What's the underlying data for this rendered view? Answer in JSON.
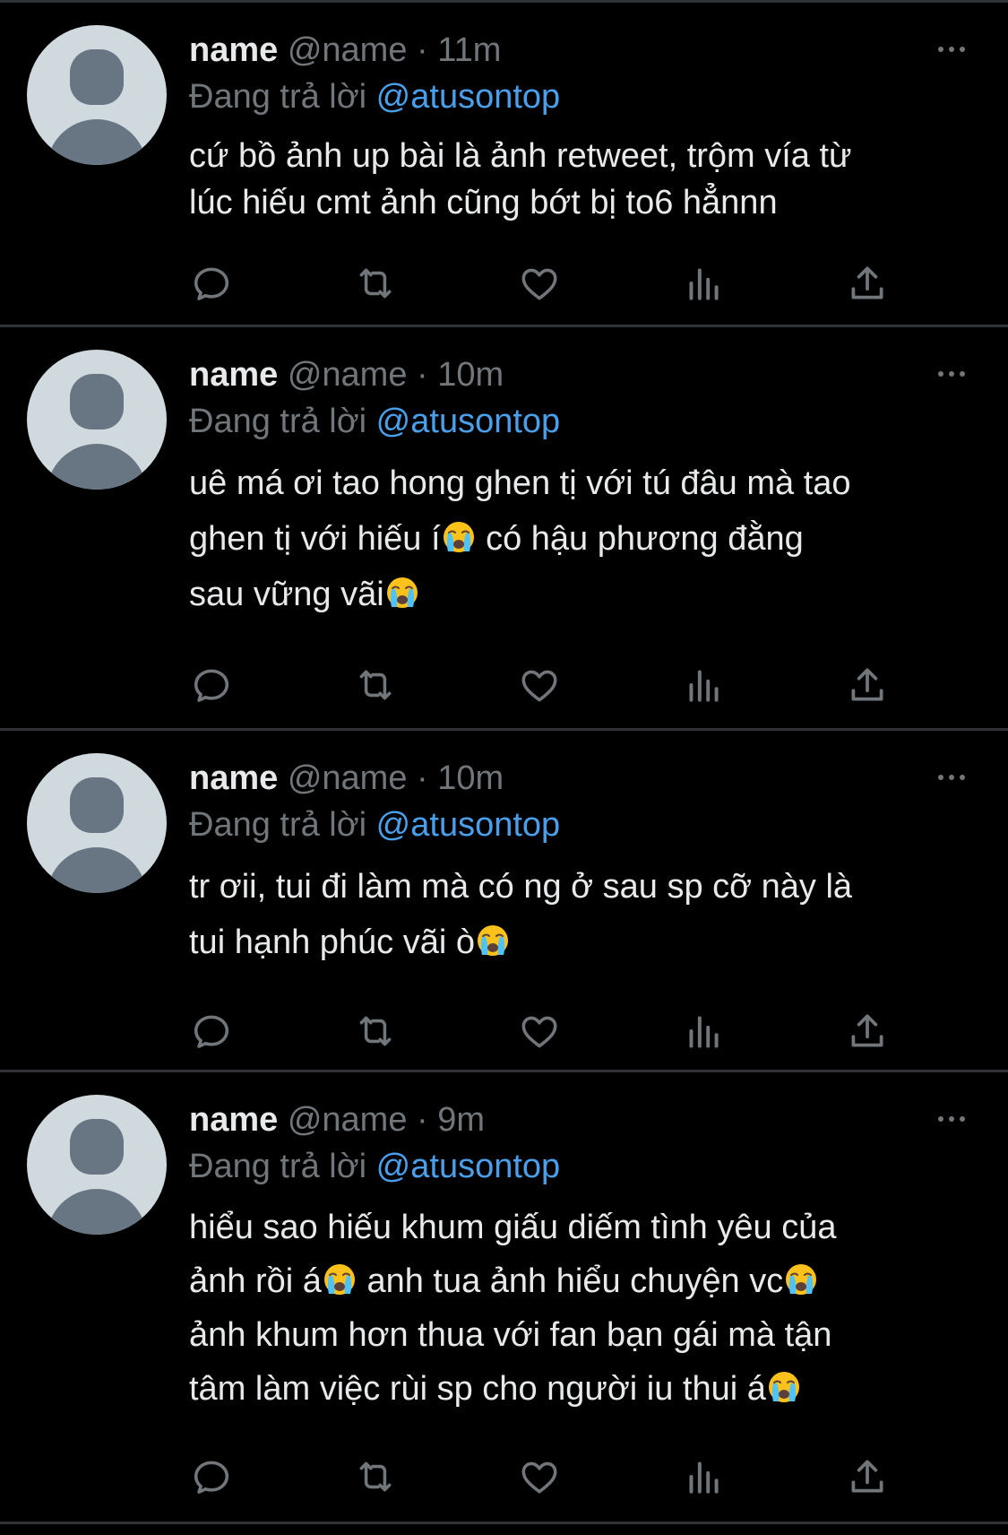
{
  "tweets": [
    {
      "name": "name",
      "handle": "@name",
      "time": "11m",
      "reply_prefix": "Đang trả lời",
      "mention": "@atusontop",
      "lines": [
        "cứ bồ ảnh up bài là ảnh retweet, trộm vía từ",
        "lúc hiếu cmt ảnh cũng bớt bị to6 hẳnnn"
      ]
    },
    {
      "name": "name",
      "handle": "@name",
      "time": "10m",
      "reply_prefix": "Đang trả lời",
      "mention": "@atusontop",
      "lines": [
        "uê má ơi tao hong ghen tị với tú đâu mà tao",
        "ghen tị với hiếu í",
        " có hậu phương đằng",
        "sau vững vãi"
      ]
    },
    {
      "name": "name",
      "handle": "@name",
      "time": "10m",
      "reply_prefix": "Đang trả lời",
      "mention": "@atusontop",
      "lines": [
        "tr ơii, tui đi làm mà có ng ở sau sp cỡ này là",
        "tui hạnh phúc vãi ò"
      ]
    },
    {
      "name": "name",
      "handle": "@name",
      "time": "9m",
      "reply_prefix": "Đang trả lời",
      "mention": "@atusontop",
      "lines": [
        "hiểu sao hiếu khum giấu diếm tình yêu của",
        "ảnh rồi á",
        " anh tua ảnh hiểu chuyện vc",
        "ảnh khum hơn thua với fan bạn gái mà tận",
        "tâm làm việc rùi sp cho người iu thui á"
      ]
    }
  ],
  "separator": " · ",
  "colors": {
    "background": "#000000",
    "divider": "#2f3336",
    "text": "#e7e9ea",
    "muted": "#71767b",
    "mention": "#4a9fea",
    "avatar_bg": "#cfd9de",
    "avatar_fg": "#687684"
  },
  "icons": [
    "more-icon",
    "reply-icon",
    "retweet-icon",
    "like-icon",
    "views-icon",
    "share-icon",
    "crying-emoji-icon"
  ]
}
